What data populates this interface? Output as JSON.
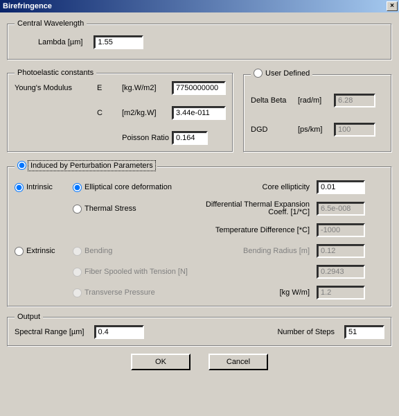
{
  "window": {
    "title": "Birefringence"
  },
  "central": {
    "legend": "Central Wavelength",
    "lambda_label": "Lambda [µm]",
    "lambda_value": "1.55"
  },
  "photoelastic": {
    "legend": "Photoelastic constants",
    "young_label": "Young's Modulus",
    "E": "E",
    "E_unit": "[kg.W/m2]",
    "E_value": "7750000000",
    "C": "C",
    "C_unit": "[m2/kg.W]",
    "C_value": "3.44e-011",
    "poisson_label": "Poisson Ratio",
    "poisson_value": "0.164"
  },
  "userdef": {
    "legend_radio": "User Defined",
    "delta_label": "Delta Beta",
    "delta_unit": "[rad/m]",
    "delta_value": "6.28",
    "dgd_label": "DGD",
    "dgd_unit": "[ps/km]",
    "dgd_value": "100"
  },
  "perturb": {
    "legend_radio": "Induced by Perturbation Parameters",
    "intrinsic": "Intrinsic",
    "extrinsic": "Extrinsic",
    "elliptical": "Elliptical core deformation",
    "thermal": "Thermal Stress",
    "bending": "Bending",
    "fiber_spooled": "Fiber Spooled with Tension [N]",
    "transverse": "Transverse Pressure",
    "core_ellipt_label": "Core ellipticity",
    "core_ellipt_value": "0.01",
    "dte_label": "Differential Thermal Expansion Coeff. [1/*C]",
    "dte_value": "6.5e-008",
    "tempdiff_label": "Temperature Difference [*C]",
    "tempdiff_value": "-1000",
    "bradius_label": "Bending Radius [m]",
    "bradius_value": "0.12",
    "fiber_value": "0.2943",
    "trans_unit": "[kg W/m]",
    "trans_value": "1.2"
  },
  "output": {
    "legend": "Output",
    "spectral_label": "Spectral Range [µm]",
    "spectral_value": "0.4",
    "steps_label": "Number of Steps",
    "steps_value": "51"
  },
  "buttons": {
    "ok": "OK",
    "cancel": "Cancel"
  }
}
